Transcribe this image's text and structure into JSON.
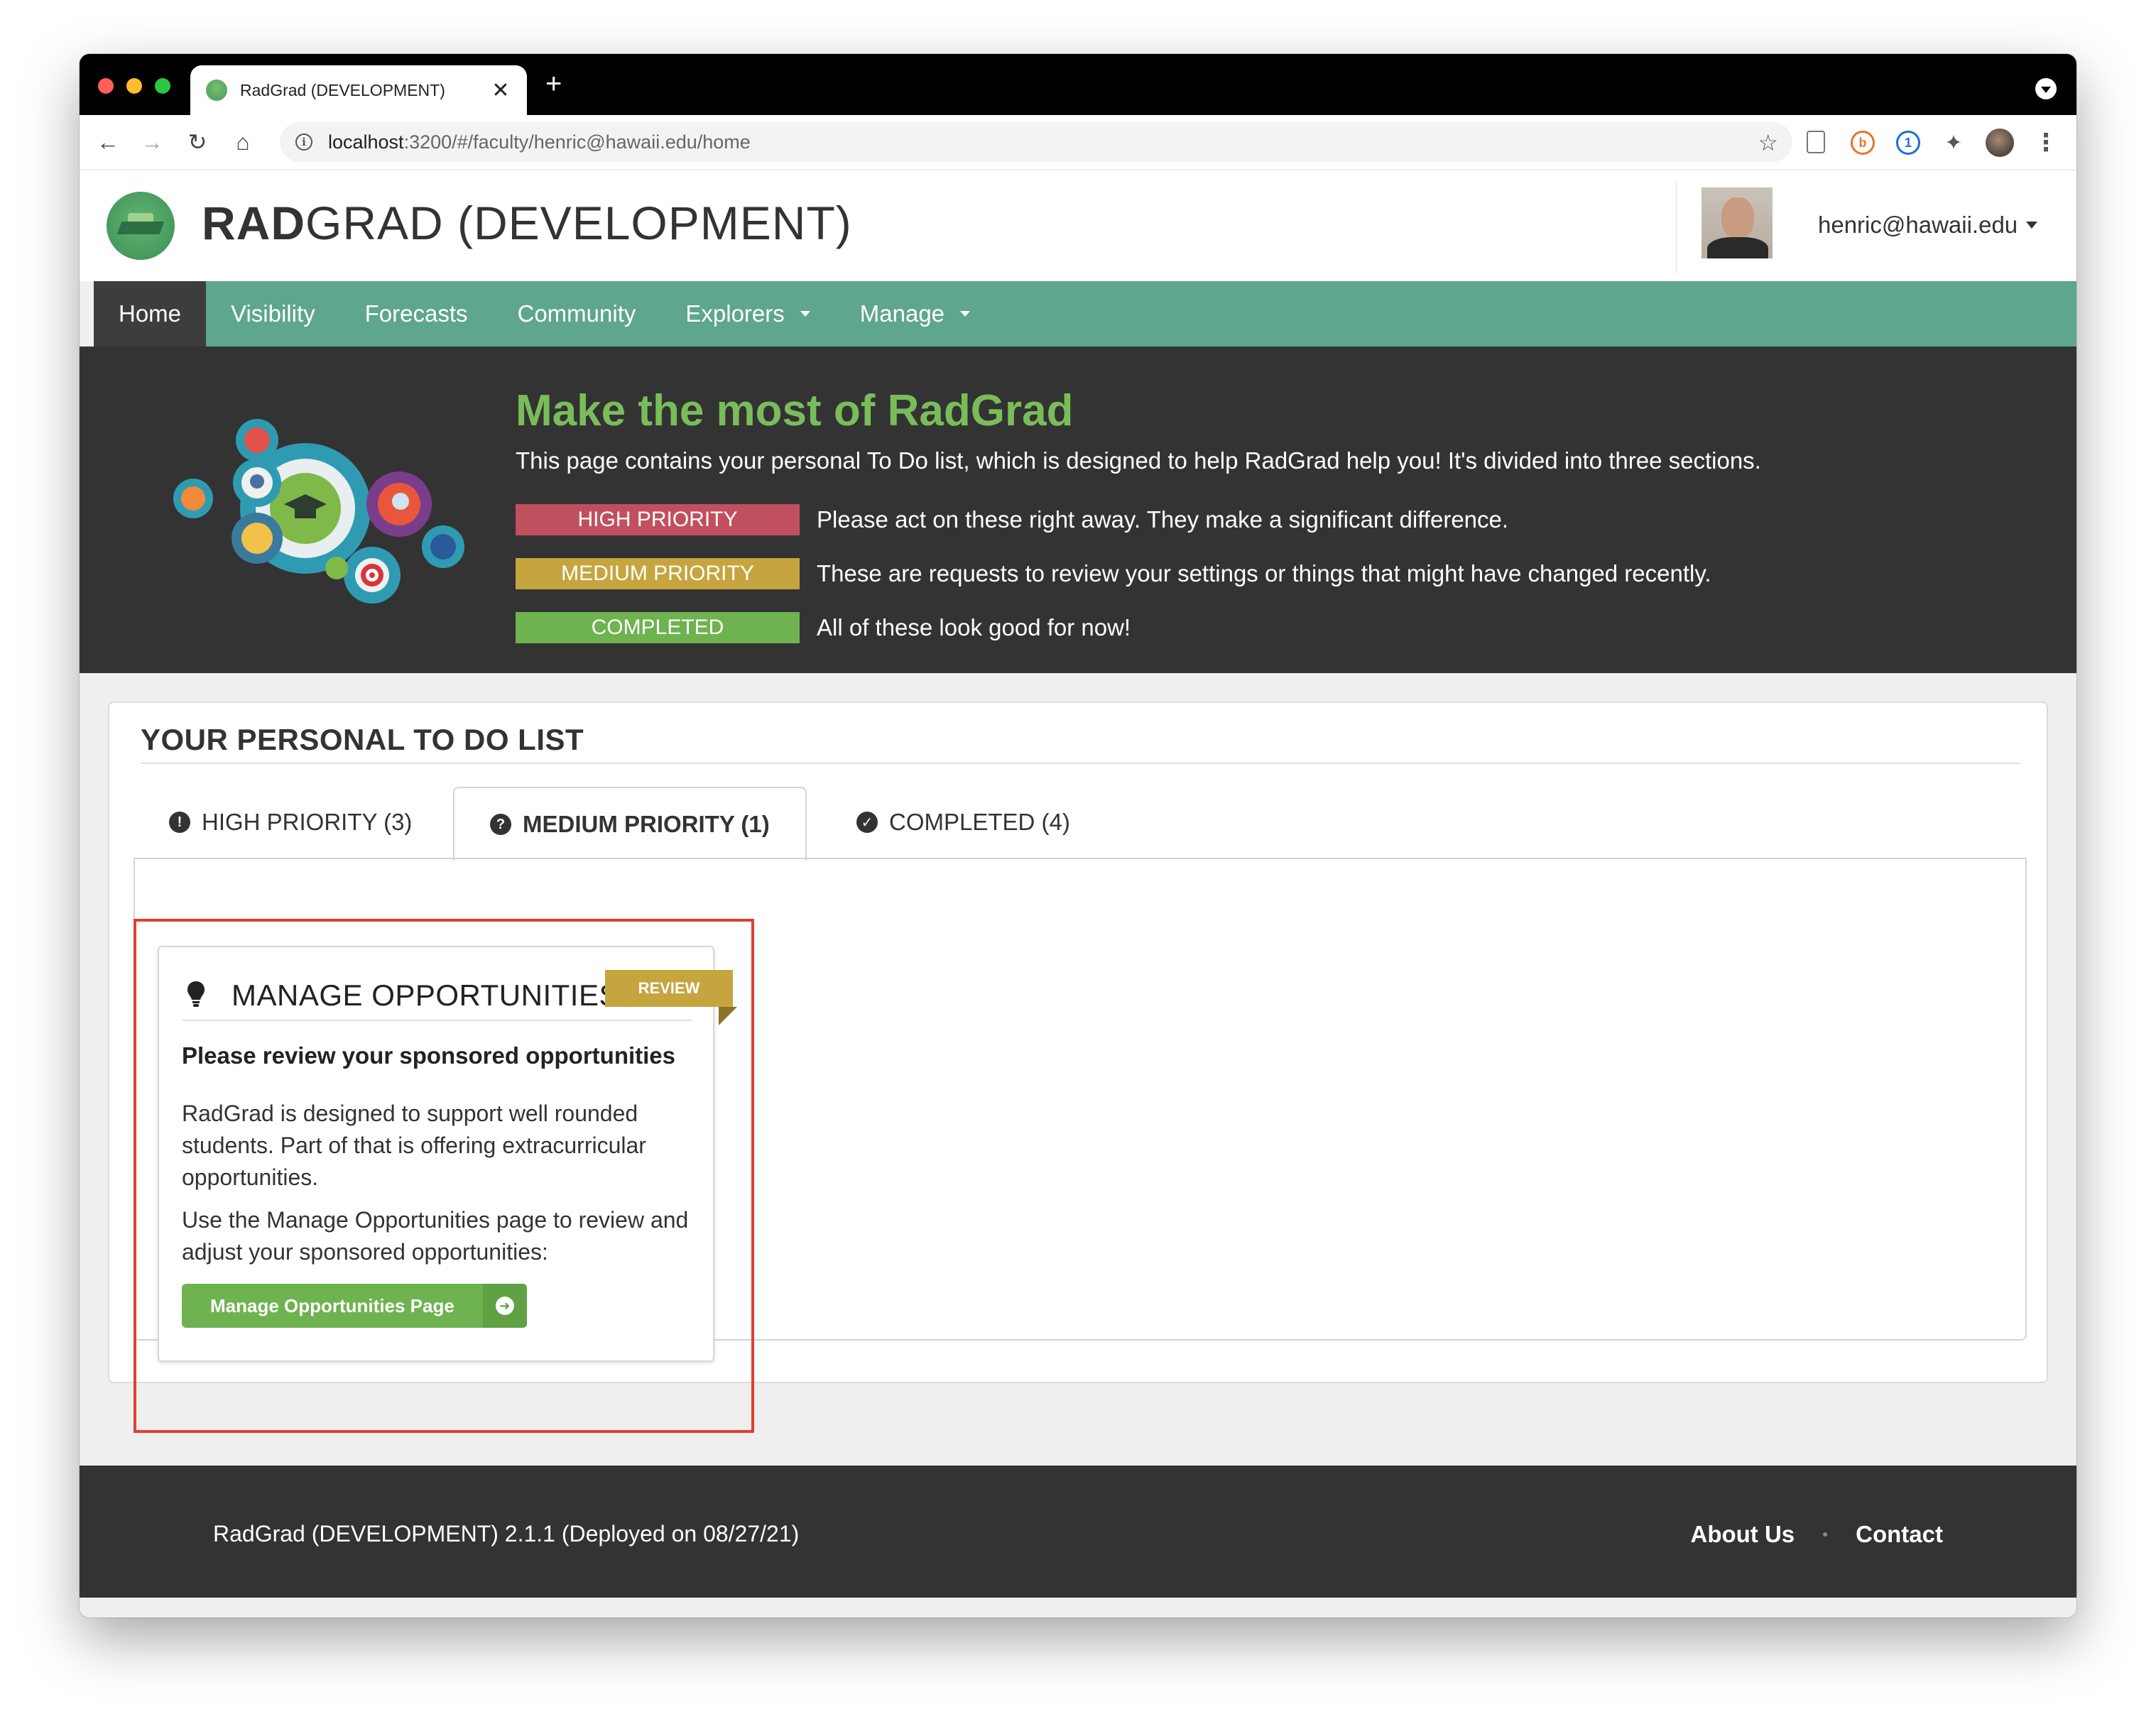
{
  "browser": {
    "tab_title": "RadGrad (DEVELOPMENT)",
    "tab_close": "✕",
    "new_tab": "+",
    "url_host": "localhost",
    "url_path": ":3200/#/faculty/henric@hawaii.edu/home",
    "nav_back": "←",
    "nav_forward": "→",
    "nav_reload": "↻",
    "nav_home": "⌂",
    "star": "☆",
    "ext_b": "b",
    "ext_1p": "1",
    "ext_puzzle": "✦",
    "ext_menu": "⋮"
  },
  "header": {
    "title_bold": "RAD",
    "title_rest": "GRAD (DEVELOPMENT)",
    "user_email": "henric@hawaii.edu"
  },
  "menu": {
    "items": [
      "Home",
      "Visibility",
      "Forecasts",
      "Community",
      "Explorers",
      "Manage"
    ],
    "active": "Home"
  },
  "hero": {
    "title": "Make the most of RadGrad",
    "subtitle": "This page contains your personal To Do list, which is designed to help RadGrad help you! It's divided into three sections.",
    "legend": [
      {
        "badge": "HIGH PRIORITY",
        "text": "Please act on these right away. They make a significant difference.",
        "color": "#c1505e"
      },
      {
        "badge": "MEDIUM PRIORITY",
        "text": "These are requests to review your settings or things that might have changed recently.",
        "color": "#c6a53f"
      },
      {
        "badge": "COMPLETED",
        "text": "All of these look good for now!",
        "color": "#6eb34f"
      }
    ]
  },
  "todo": {
    "title": "YOUR PERSONAL TO DO LIST",
    "tabs": [
      {
        "label": "HIGH PRIORITY (3)",
        "icon": "!"
      },
      {
        "label": "MEDIUM PRIORITY (1)",
        "icon": "?"
      },
      {
        "label": "COMPLETED (4)",
        "icon": "✓"
      }
    ],
    "active_tab": "MEDIUM PRIORITY (1)",
    "task": {
      "title": "MANAGE OPPORTUNITIES",
      "ribbon": "REVIEW",
      "heading": "Please review your sponsored opportunities",
      "p1": "RadGrad is designed to support well rounded students. Part of that is offering extracurricular opportunities.",
      "p2": "Use the Manage Opportunities page to review and adjust your sponsored opportunities:",
      "button_label": "Manage Opportunities Page",
      "button_icon": "➜"
    }
  },
  "footer": {
    "version": "RadGrad (DEVELOPMENT) 2.1.1 (Deployed on 08/27/21)",
    "about": "About Us",
    "contact": "Contact"
  },
  "colors": {
    "menu_green": "#5ea68e",
    "hero_title_green": "#79bd5a",
    "dark": "#333333",
    "highlight_red": "#e13f2f"
  }
}
